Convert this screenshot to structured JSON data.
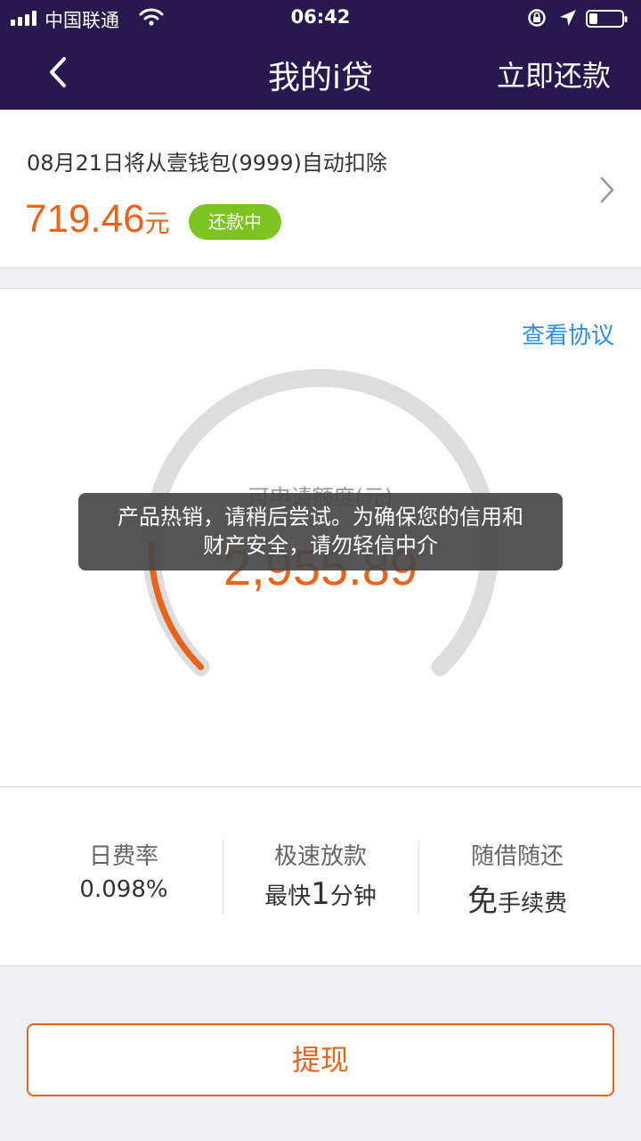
{
  "status_bar": {
    "carrier": "中国联通",
    "time": "06:42"
  },
  "nav": {
    "title": "我的i贷",
    "action": "立即还款"
  },
  "repayment": {
    "text": "08月21日将从壹钱包(9999)自动扣除",
    "amount": "719.46",
    "unit": "元",
    "badge": "还款中"
  },
  "credit": {
    "agreement_link": "查看协议",
    "label": "可申请额度(元)",
    "amount": "2,955.89",
    "used_fraction": 0.17
  },
  "toast": {
    "line1": "产品热销，请稍后尝试。为确保您的信用和",
    "line2": "财产安全，请勿轻信中介"
  },
  "features": {
    "daily_rate_title": "日费率",
    "daily_rate_value": "0.098%",
    "speed_title": "极速放款",
    "speed_prefix": "最快",
    "speed_number": "1",
    "speed_suffix": "分钟",
    "repay_title": "随借随还",
    "fee_prefix": "免",
    "fee_suffix": "手续费"
  },
  "withdraw_button": "提现",
  "colors": {
    "header_bg": "#27194f",
    "accent_orange": "#e8641b",
    "badge_green": "#7dc421",
    "link_blue": "#2f8ee0"
  }
}
